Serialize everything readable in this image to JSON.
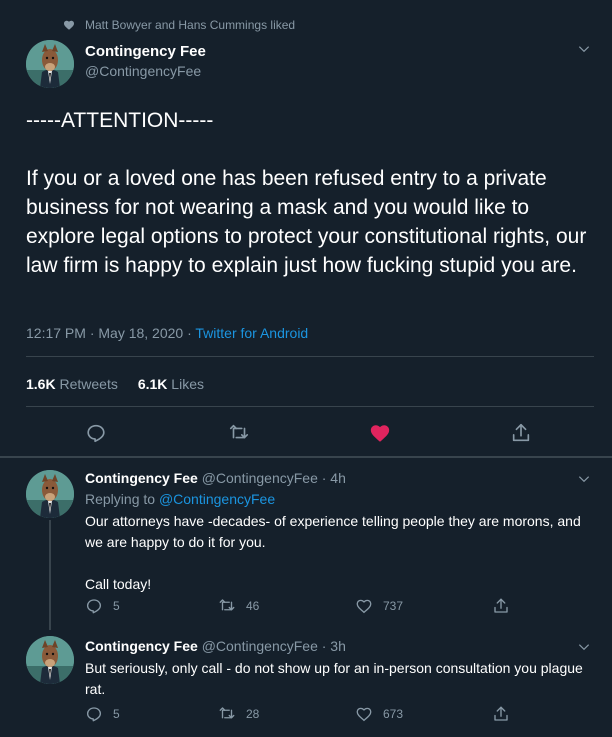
{
  "liked_by": "Matt Bowyer and Hans Cummings liked",
  "main_tweet": {
    "name": "Contingency Fee",
    "handle": "@ContingencyFee",
    "text": "-----ATTENTION-----\n\nIf you or a loved one has been refused entry to a private business for not wearing a mask and you would like to explore legal options to protect your constitutional rights, our law firm is happy to explain just how fucking stupid you are.",
    "timestamp": "12:17 PM · May 18, 2020 · ",
    "source": "Twitter for Android",
    "retweets_count": "1.6K",
    "retweets_label": "Retweets",
    "likes_count": "6.1K",
    "likes_label": "Likes",
    "liked": true,
    "like_color": "#e0245e"
  },
  "replies": [
    {
      "name": "Contingency Fee",
      "handle_time": "@ContingencyFee · 4h",
      "replying_prefix": "Replying to ",
      "replying_to": "@ContingencyFee",
      "text": "Our attorneys have -decades- of experience telling people they are morons, and we are happy to do it for you.\n\nCall today!",
      "reply_count": "5",
      "retweet_count": "46",
      "like_count": "737"
    },
    {
      "name": "Contingency Fee",
      "handle_time": "@ContingencyFee · 3h",
      "text": "But seriously, only call - do not show up for an in-person consultation you plague rat.",
      "reply_count": "5",
      "retweet_count": "28",
      "like_count": "673"
    }
  ],
  "icons": {
    "liked_heart": "heart-icon",
    "menu": "chevron-down-icon",
    "reply": "reply-icon",
    "retweet": "retweet-icon",
    "like": "like-icon",
    "share": "share-icon"
  },
  "colors": {
    "background": "#15202b",
    "text": "#ffffff",
    "muted": "#8899a6",
    "link": "#1b95e0",
    "divider": "#38444d",
    "like_active": "#e0245e"
  }
}
